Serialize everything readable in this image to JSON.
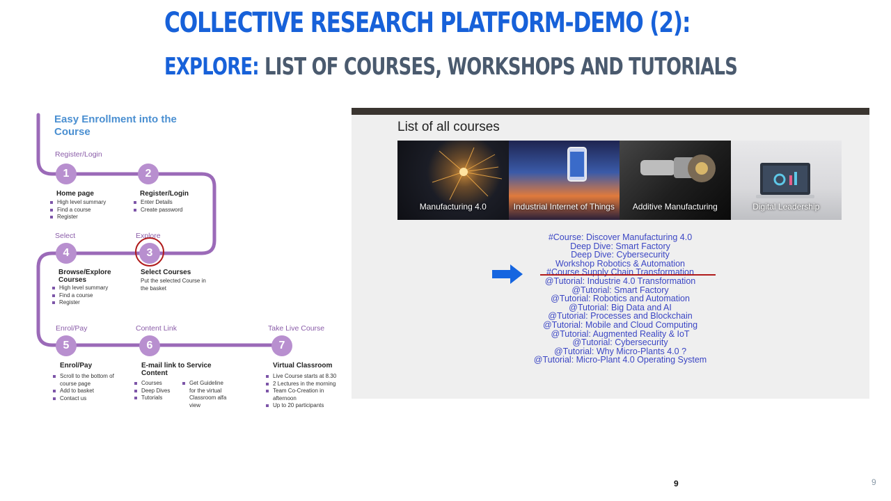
{
  "slide": {
    "title_line1": "Collective Research Platform-Demo (2):",
    "title_line2_accent": "Explore:",
    "title_line2_rest": " List of courses, workshops and tutorials",
    "page_number_center": "9",
    "page_number_corner": "9"
  },
  "enrollment": {
    "heading": "Easy Enrollment into the Course",
    "stages": {
      "register": "Register/Login",
      "select": "Select",
      "explore": "Explore",
      "enrol": "Enrol/Pay",
      "content": "Content Link",
      "live": "Take Live Course"
    },
    "steps": [
      {
        "num": "1",
        "title": "Home page",
        "bullets": [
          "High level summary",
          "Find a course",
          "Register"
        ]
      },
      {
        "num": "2",
        "title": "Register/Login",
        "bullets": [
          "Enter Details",
          "Create password"
        ]
      },
      {
        "num": "3",
        "title": "Select Courses",
        "desc": "Put the selected Course in the basket"
      },
      {
        "num": "4",
        "title": "Browse/Explore Courses",
        "bullets": [
          "High level summary",
          "Find a course",
          "Register"
        ]
      },
      {
        "num": "5",
        "title": "Enrol/Pay",
        "bullets": [
          "Scroll to the bottom of course page",
          "Add to basket",
          "Contact us"
        ]
      },
      {
        "num": "6",
        "title": "E-mail link to Service Content",
        "bullets": [
          "Courses",
          "Deep Dives",
          "Tutorials"
        ],
        "bullets2": [
          "Get Guideline for the virtual Classroom alfa view"
        ]
      },
      {
        "num": "7",
        "title": "Virtual Classroom",
        "bullets": [
          "Live Course starts at 8.30",
          "2 Lectures in the morning",
          "Team Co-Creation in afternoon",
          "Up to 20 participants"
        ]
      }
    ]
  },
  "courses_panel": {
    "title": "List of all courses",
    "tiles": [
      "Manufacturing 4.0",
      "Industrial Internet of Things",
      "Additive Manufacturing",
      "Digital Leadership"
    ],
    "links": [
      "#Course: Discover Manufacturing 4.0",
      "Deep Dive: Smart Factory",
      "Deep Dive: Cybersecurity",
      "Workshop Robotics & Automation",
      "#Course Supply Chain Transformation",
      "@Tutorial: Industrie 4.0 Transformation",
      "@Tutorial: Smart Factory",
      "@Tutorial: Robotics and Automation",
      "@Tutorial: Big Data and AI",
      "@Tutorial: Processes and Blockchain",
      "@Tutorial: Mobile and Cloud Computing",
      "@Tutorial: Augmented Reality & IoT",
      "@Tutorial: Cybersecurity",
      "@Tutorial: Why Micro-Plants 4.0 ?",
      "@Tutorial: Micro-Plant 4.0 Operating System"
    ]
  },
  "colors": {
    "title_blue": "#1761d9",
    "title_gray": "#4a5a6e",
    "path_purple": "#9b6ab8",
    "circle_purple": "#b88fcf",
    "link_blue": "#3b46c4",
    "highlight_red": "#b01b1b",
    "arrow_blue": "#1565e0"
  },
  "icons": {
    "pointer": "arrow-right-icon"
  }
}
